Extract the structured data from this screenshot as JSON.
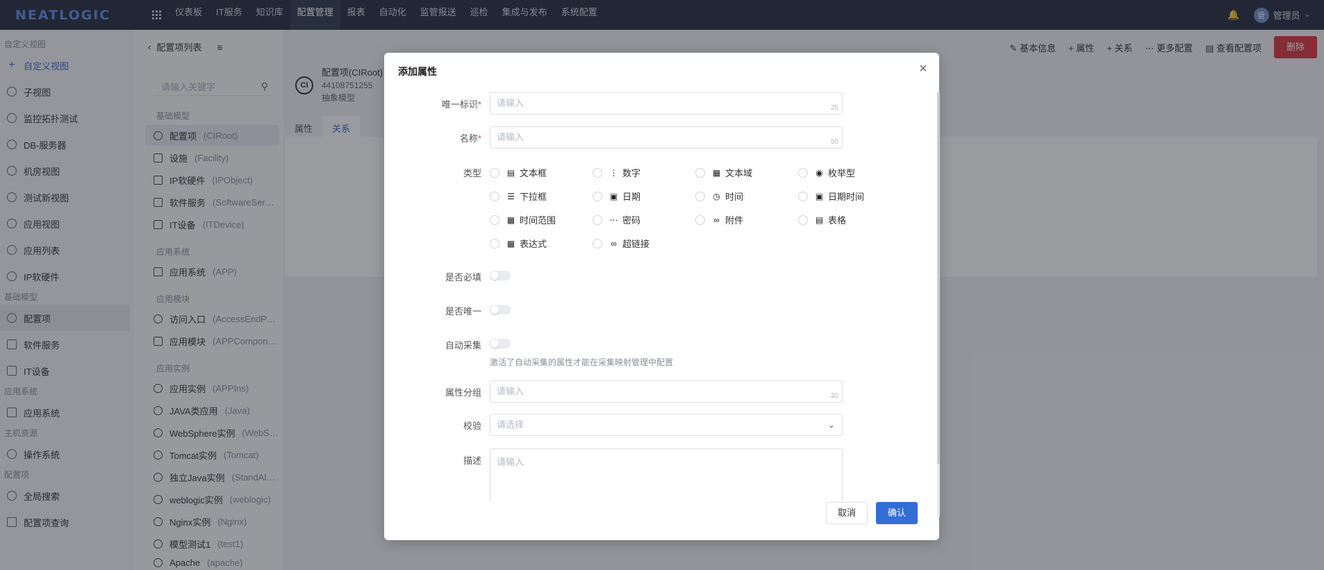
{
  "topnav": {
    "logo": "NEATLOGIC",
    "menu": [
      "仪表板",
      "IT服务",
      "知识库",
      "配置管理",
      "报表",
      "自动化",
      "监管报送",
      "巡检",
      "集成与发布",
      "系统配置"
    ],
    "active_index": 3,
    "user_avatar": "管",
    "user_name": "管理员"
  },
  "sidebar": {
    "group_custom": "自定义视图",
    "add_view": "自定义视图",
    "views": [
      "子视图",
      "监控拓扑测试",
      "DB-服务器",
      "机房视图",
      "测试新视图",
      "应用视图",
      "应用列表",
      "IP软硬件"
    ],
    "group_basic": "基础模型",
    "basic": [
      "配置项",
      "软件服务",
      "IT设备"
    ],
    "group_app": "应用系统",
    "app": [
      "应用系统"
    ],
    "group_host": "主机资源",
    "host": [
      "操作系统"
    ],
    "group_ci": "配置项",
    "ci": [
      "全局搜索",
      "配置项查询"
    ]
  },
  "models": {
    "back_label": "配置项列表",
    "search_placeholder": "请输入关键字",
    "group_basic": "基础模型",
    "group_app_system": "应用系统",
    "group_app_module": "应用模块",
    "group_app_instance": "应用实例",
    "items": [
      {
        "name": "配置项",
        "en": "(CIRoot)"
      },
      {
        "name": "设施",
        "en": "(Facility)"
      },
      {
        "name": "IP软硬件",
        "en": "(IPObject)"
      },
      {
        "name": "软件服务",
        "en": "(SoftwareSer…"
      },
      {
        "name": "IT设备",
        "en": "(ITDevice)"
      },
      {
        "name": "应用系统",
        "en": "(APP)"
      },
      {
        "name": "访问入口",
        "en": "(AccessEndP…"
      },
      {
        "name": "应用模块",
        "en": "(APPCompon…"
      },
      {
        "name": "应用实例",
        "en": "(APPIns)"
      },
      {
        "name": "JAVA类应用",
        "en": "(Java)"
      },
      {
        "name": "WebSphere实例",
        "en": "(WebS…"
      },
      {
        "name": "Tomcat实例",
        "en": "(Tomcat)"
      },
      {
        "name": "独立Java实例",
        "en": "(StandAl…"
      },
      {
        "name": "weblogic实例",
        "en": "(weblogic)"
      },
      {
        "name": "Nginx实例",
        "en": "(Nginx)"
      },
      {
        "name": "模型测试1",
        "en": "(test1)"
      },
      {
        "name": "Apache",
        "en": "(apache)"
      }
    ]
  },
  "main": {
    "toolbar": [
      "基本信息",
      "属性",
      "关系",
      "更多配置",
      "查看配置项"
    ],
    "delete_label": "删除",
    "ci_badge": "CI",
    "ci_title": "配置项(CIRoot)",
    "ci_id": "44108751255",
    "ci_type": "抽象模型",
    "tab_attr": "属性",
    "tab_rel": "关系"
  },
  "dialog": {
    "title": "添加属性",
    "close": "×",
    "label_key": "唯一标识",
    "label_name": "名称",
    "label_type": "类型",
    "label_required": "是否必填",
    "label_unique": "是否唯一",
    "label_auto": "自动采集",
    "auto_hint": "激活了自动采集的属性才能在采集映射管理中配置",
    "label_group": "属性分组",
    "label_validate": "校验",
    "label_desc": "描述",
    "placeholder_input": "请输入",
    "placeholder_select": "请选择",
    "key_max": "25",
    "name_max": "50",
    "group_max": "30",
    "types": [
      "文本框",
      "数字",
      "文本域",
      "枚举型",
      "下拉框",
      "日期",
      "时间",
      "日期时间",
      "时间范围",
      "密码",
      "附件",
      "表格",
      "表达式",
      "超链接"
    ],
    "type_selected": "枚举型",
    "cancel": "取消",
    "confirm": "确认"
  }
}
